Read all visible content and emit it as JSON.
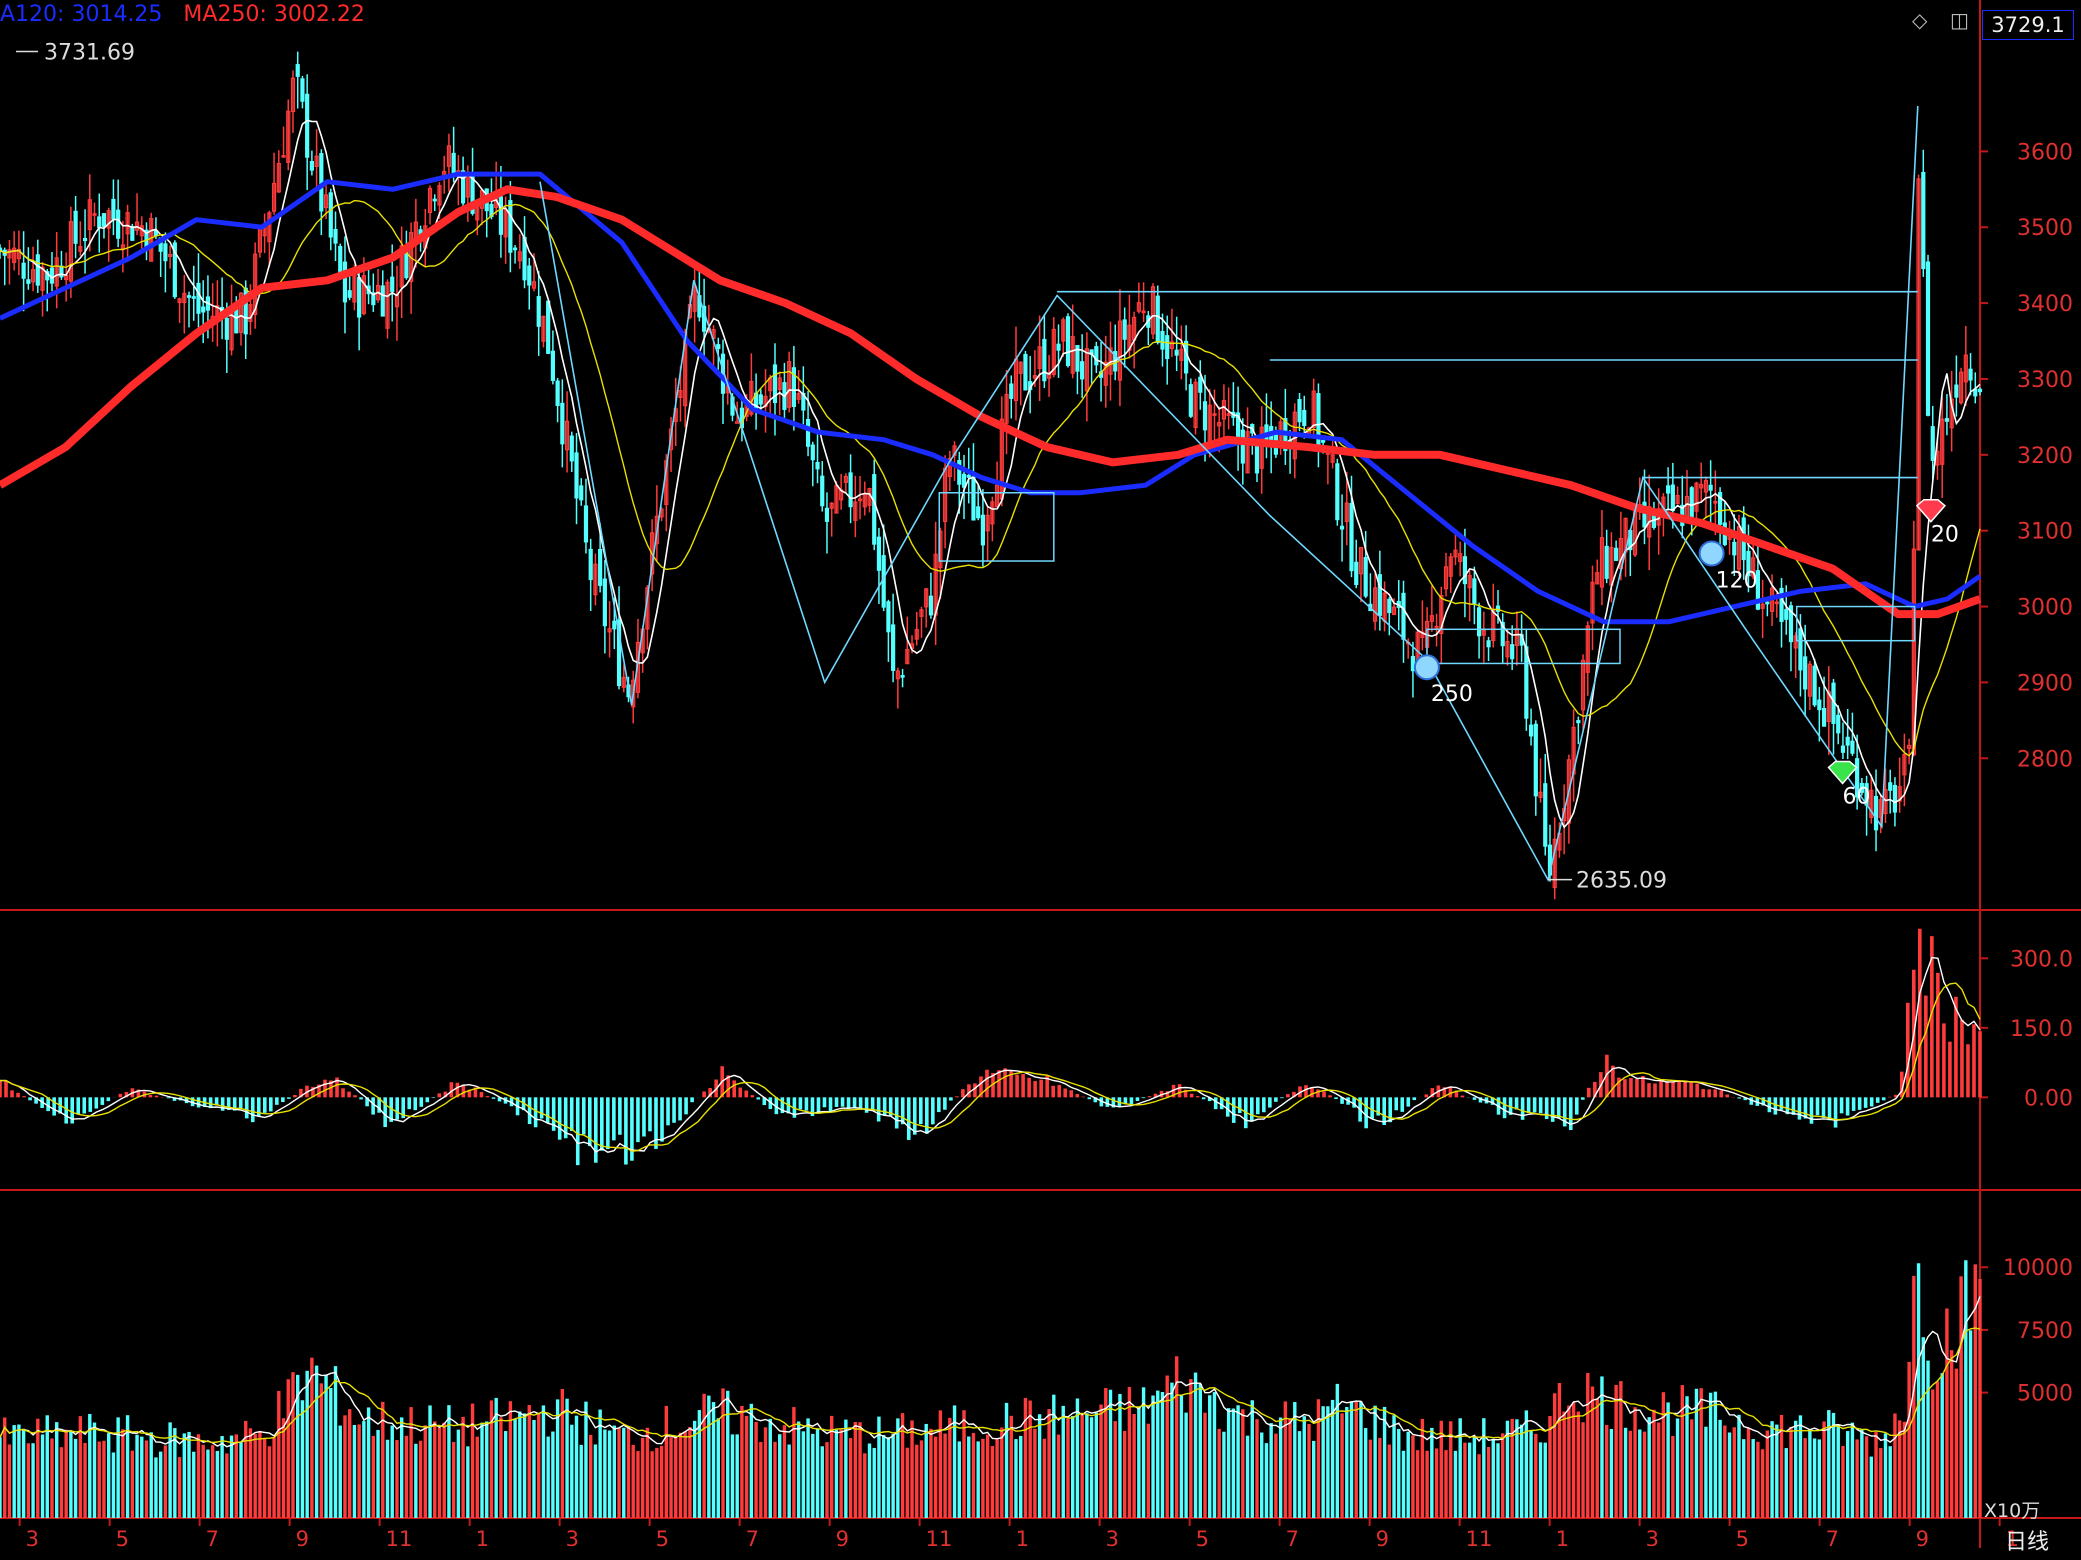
{
  "header": {
    "ma120_label": "A120: 3014.25",
    "ma250_label": "MA250: 3002.22",
    "ma120_color": "#1a2cff",
    "ma250_color": "#ff2a2a",
    "current_price": "3729.1"
  },
  "toolbar": {
    "diamond_icon": "diamond-outline-icon",
    "window_icon": "window-toggle-icon"
  },
  "period_label": "日线",
  "volume_unit": "X10万",
  "chart_data": [
    {
      "type": "candlestick",
      "panel": "price",
      "ylim": [
        2600,
        3760
      ],
      "y_ticks": [
        "3600",
        "3500",
        "3400",
        "3300",
        "3200",
        "3100",
        "3000",
        "2900",
        "2800"
      ],
      "high_label": "3731.69",
      "low_label": "2635.09",
      "x_ticks": [
        "3",
        "5",
        "7",
        "9",
        "11",
        "1",
        "3",
        "5",
        "7",
        "9",
        "11",
        "1",
        "3",
        "5",
        "7",
        "9",
        "11",
        "1",
        "3",
        "5",
        "7",
        "9",
        "1"
      ],
      "close_path": [
        [
          0,
          3470
        ],
        [
          1.5,
          3440
        ],
        [
          3,
          3520
        ],
        [
          4.5,
          3500
        ],
        [
          6,
          3390
        ],
        [
          7.5,
          3380
        ],
        [
          9,
          3690
        ],
        [
          10.5,
          3410
        ],
        [
          12,
          3420
        ],
        [
          13.5,
          3590
        ],
        [
          15,
          3520
        ],
        [
          16,
          3470
        ],
        [
          16.8,
          3340
        ],
        [
          18,
          3050
        ],
        [
          19.2,
          2890
        ],
        [
          21.3,
          3420
        ],
        [
          22.5,
          3250
        ],
        [
          24.2,
          3300
        ],
        [
          25.2,
          3110
        ],
        [
          26.5,
          3170
        ],
        [
          27.3,
          2900
        ],
        [
          28.5,
          3020
        ],
        [
          29,
          3200
        ],
        [
          30,
          3110
        ],
        [
          31,
          3290
        ],
        [
          32.5,
          3350
        ],
        [
          33.5,
          3290
        ],
        [
          35,
          3410
        ],
        [
          36.5,
          3270
        ],
        [
          38.5,
          3200
        ],
        [
          40,
          3270
        ],
        [
          40.5,
          3200
        ],
        [
          41.5,
          3050
        ],
        [
          43.5,
          2930
        ],
        [
          44.3,
          3080
        ],
        [
          45.3,
          2980
        ],
        [
          46.5,
          2930
        ],
        [
          47.3,
          2640
        ],
        [
          48,
          2810
        ],
        [
          48.8,
          3050
        ],
        [
          50,
          3100
        ],
        [
          52.3,
          3150
        ],
        [
          54,
          3000
        ],
        [
          55.5,
          2890
        ],
        [
          57.5,
          2720
        ],
        [
          58.4,
          2790
        ],
        [
          58.6,
          3600
        ],
        [
          59,
          3180
        ],
        [
          60,
          3340
        ],
        [
          60.5,
          3300
        ]
      ],
      "series": [
        {
          "name": "MA120",
          "values": [
            [
              0,
              3380
            ],
            [
              2,
              3420
            ],
            [
              4,
              3460
            ],
            [
              6,
              3510
            ],
            [
              8,
              3500
            ],
            [
              10,
              3560
            ],
            [
              12,
              3550
            ],
            [
              14,
              3570
            ],
            [
              16.5,
              3570
            ],
            [
              19,
              3480
            ],
            [
              21,
              3350
            ],
            [
              23,
              3260
            ],
            [
              25,
              3230
            ],
            [
              27,
              3220
            ],
            [
              28.5,
              3200
            ],
            [
              30,
              3170
            ],
            [
              31.5,
              3150
            ],
            [
              33,
              3150
            ],
            [
              35,
              3160
            ],
            [
              36.5,
              3200
            ],
            [
              39,
              3230
            ],
            [
              41,
              3220
            ],
            [
              43,
              3150
            ],
            [
              45,
              3080
            ],
            [
              47,
              3020
            ],
            [
              49,
              2980
            ],
            [
              51,
              2980
            ],
            [
              53,
              3000
            ],
            [
              55,
              3020
            ],
            [
              57,
              3030
            ],
            [
              58.5,
              3000
            ],
            [
              59.5,
              3010
            ],
            [
              60.5,
              3040
            ]
          ]
        },
        {
          "name": "MA250",
          "values": [
            [
              0,
              3160
            ],
            [
              2,
              3210
            ],
            [
              4,
              3290
            ],
            [
              6,
              3360
            ],
            [
              8,
              3420
            ],
            [
              10,
              3430
            ],
            [
              12,
              3460
            ],
            [
              14,
              3520
            ],
            [
              15.5,
              3550
            ],
            [
              17,
              3540
            ],
            [
              19,
              3510
            ],
            [
              22,
              3430
            ],
            [
              24,
              3400
            ],
            [
              26,
              3360
            ],
            [
              28,
              3300
            ],
            [
              30,
              3250
            ],
            [
              32,
              3210
            ],
            [
              34,
              3190
            ],
            [
              36,
              3200
            ],
            [
              37.5,
              3220
            ],
            [
              40,
              3210
            ],
            [
              42,
              3200
            ],
            [
              44,
              3200
            ],
            [
              46,
              3180
            ],
            [
              48,
              3160
            ],
            [
              50,
              3130
            ],
            [
              52,
              3110
            ],
            [
              54,
              3080
            ],
            [
              56,
              3050
            ],
            [
              58,
              2990
            ],
            [
              59.2,
              2990
            ],
            [
              60.5,
              3010
            ]
          ]
        }
      ],
      "signals": [
        {
          "label": "250",
          "x": 43.6,
          "y": 2920,
          "kind": "blue-ball"
        },
        {
          "label": "120",
          "x": 52.3,
          "y": 3070,
          "kind": "blue-ball"
        },
        {
          "label": "60",
          "x": 56.3,
          "y": 2780,
          "kind": "green-diamond"
        },
        {
          "label": "20",
          "x": 59,
          "y": 3125,
          "kind": "red-diamond"
        }
      ]
    },
    {
      "type": "bar",
      "panel": "oscillator",
      "ylim": [
        -200,
        400
      ],
      "y_ticks": [
        "300.0",
        "150.0",
        "0.00"
      ],
      "series": [
        {
          "name": "histogram",
          "values": [
            [
              0,
              40
            ],
            [
              2,
              -60
            ],
            [
              4,
              20
            ],
            [
              6,
              -20
            ],
            [
              8,
              -50
            ],
            [
              10,
              60
            ],
            [
              12,
              -70
            ],
            [
              14,
              40
            ],
            [
              16,
              -40
            ],
            [
              18,
              -140
            ],
            [
              20,
              -120
            ],
            [
              22,
              60
            ],
            [
              24,
              -50
            ],
            [
              26,
              -20
            ],
            [
              28,
              -90
            ],
            [
              30,
              60
            ],
            [
              32,
              40
            ],
            [
              34,
              -30
            ],
            [
              36,
              30
            ],
            [
              38,
              -60
            ],
            [
              40,
              40
            ],
            [
              42,
              -70
            ],
            [
              44,
              30
            ],
            [
              46,
              -40
            ],
            [
              48,
              -60
            ],
            [
              49,
              90
            ],
            [
              50,
              40
            ],
            [
              52,
              30
            ],
            [
              54,
              -30
            ],
            [
              56,
              -60
            ],
            [
              58,
              10
            ],
            [
              58.6,
              380
            ],
            [
              59.5,
              200
            ],
            [
              60.5,
              170
            ]
          ]
        }
      ]
    },
    {
      "type": "bar",
      "panel": "volume",
      "ylim": [
        0,
        13000
      ],
      "y_ticks": [
        "10000",
        "7500",
        "5000"
      ],
      "series": [
        {
          "name": "volume",
          "values": [
            [
              0,
              3200
            ],
            [
              3,
              3400
            ],
            [
              6,
              3000
            ],
            [
              8,
              3300
            ],
            [
              9.5,
              5900
            ],
            [
              11,
              3900
            ],
            [
              14,
              3600
            ],
            [
              17,
              4300
            ],
            [
              19,
              3200
            ],
            [
              22,
              4200
            ],
            [
              25,
              3400
            ],
            [
              27,
              3300
            ],
            [
              29,
              3600
            ],
            [
              32,
              4000
            ],
            [
              35,
              4400
            ],
            [
              36,
              5500
            ],
            [
              38,
              4000
            ],
            [
              40,
              3800
            ],
            [
              41,
              4500
            ],
            [
              43,
              3300
            ],
            [
              45,
              3200
            ],
            [
              47,
              3500
            ],
            [
              48,
              5200
            ],
            [
              50,
              4400
            ],
            [
              52,
              4200
            ],
            [
              54,
              3600
            ],
            [
              56,
              3500
            ],
            [
              57.5,
              3000
            ],
            [
              58.3,
              5000
            ],
            [
              58.6,
              11500
            ],
            [
              59,
              6500
            ],
            [
              60.5,
              9200
            ]
          ]
        }
      ]
    }
  ]
}
